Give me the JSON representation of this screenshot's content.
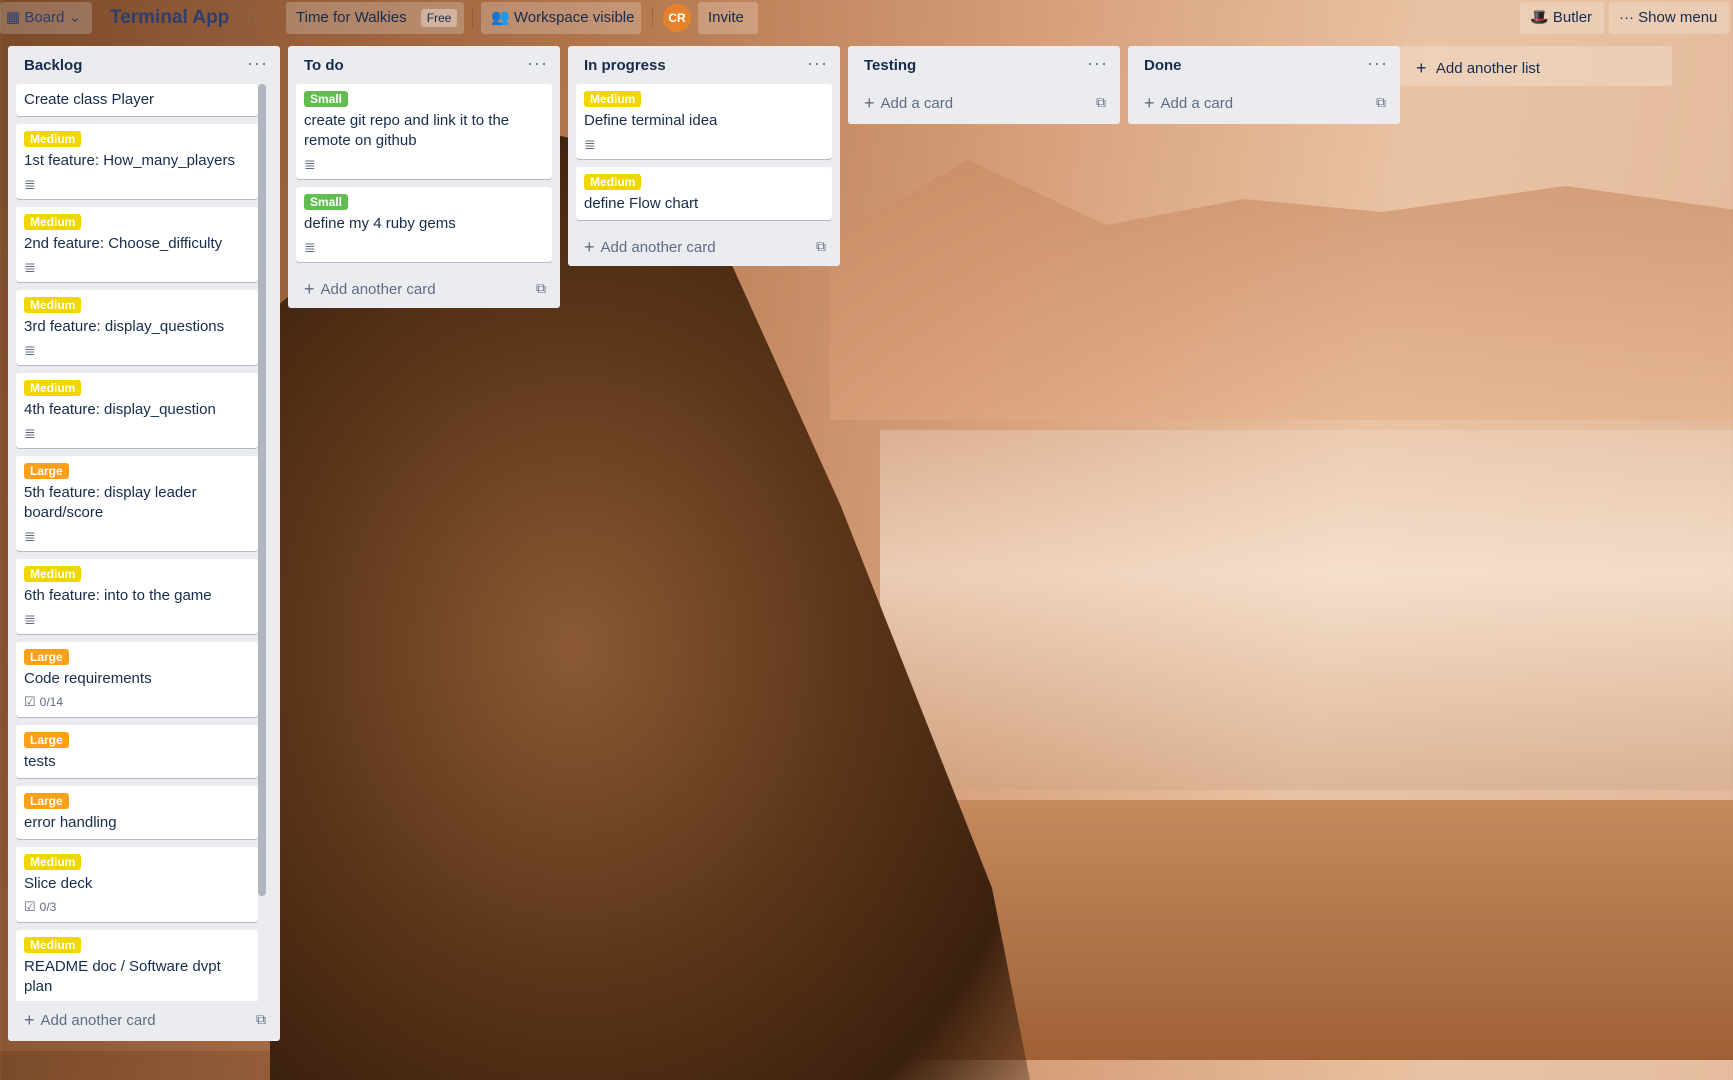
{
  "colors": {
    "medium": "#f2d600",
    "small": "#61bd4f",
    "large": "#ff9f1a",
    "avatar": "#e8812b"
  },
  "topbar": {
    "board_view_label": "Board",
    "board_title": "Terminal App",
    "workspace_name": "Time for Walkies",
    "workspace_plan": "Free",
    "visibility_label": "Workspace visible",
    "avatar_initials": "CR",
    "invite_label": "Invite",
    "butler_label": "Butler",
    "menu_label": "Show menu"
  },
  "lists": [
    {
      "title": "Backlog",
      "footer": "Add another card",
      "cards": [
        {
          "label": "",
          "title": "Create class Player",
          "badge": ""
        },
        {
          "label": "Medium",
          "title": "1st feature: How_many_players",
          "badge": "desc"
        },
        {
          "label": "Medium",
          "title": "2nd feature: Choose_difficulty",
          "badge": "desc"
        },
        {
          "label": "Medium",
          "title": "3rd feature: display_questions",
          "badge": "desc"
        },
        {
          "label": "Medium",
          "title": "4th feature: display_question",
          "badge": "desc"
        },
        {
          "label": "Large",
          "title": "5th feature: display leader board/score",
          "badge": "desc"
        },
        {
          "label": "Medium",
          "title": "6th feature: into to the game",
          "badge": "desc"
        },
        {
          "label": "Large",
          "title": "Code requirements",
          "badge": "0/14"
        },
        {
          "label": "Large",
          "title": "tests",
          "badge": ""
        },
        {
          "label": "Large",
          "title": "error handling",
          "badge": ""
        },
        {
          "label": "Medium",
          "title": "Slice deck",
          "badge": "0/3"
        },
        {
          "label": "Medium",
          "title": "README doc / Software dvpt plan",
          "badge": ""
        }
      ]
    },
    {
      "title": "To do",
      "footer": "Add another card",
      "cards": [
        {
          "label": "Small",
          "title": "create git repo and link it to the remote on github",
          "badge": "desc"
        },
        {
          "label": "Small",
          "title": "define my 4 ruby gems",
          "badge": "desc"
        }
      ]
    },
    {
      "title": "In progress",
      "footer": "Add another card",
      "cards": [
        {
          "label": "Medium",
          "title": "Define terminal idea",
          "badge": "desc"
        },
        {
          "label": "Medium",
          "title": "define Flow chart",
          "badge": ""
        }
      ]
    },
    {
      "title": "Testing",
      "footer": "Add a card",
      "cards": []
    },
    {
      "title": "Done",
      "footer": "Add a card",
      "cards": []
    }
  ],
  "add_list_label": "Add another list"
}
